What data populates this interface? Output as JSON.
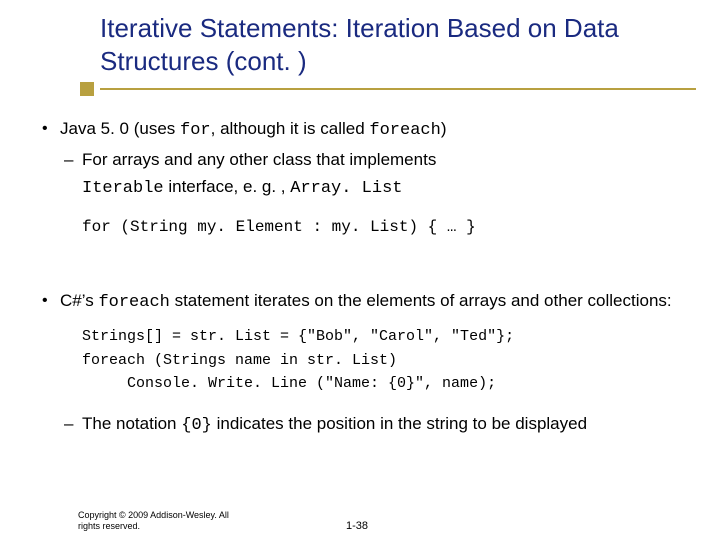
{
  "title": "Iterative Statements: Iteration Based on Data Structures (cont. )",
  "java": {
    "lead_a": "Java 5. 0 (uses ",
    "code_for": "for",
    "lead_b": ", although it is called ",
    "code_foreach": "foreach",
    "lead_c": ")",
    "sub1": "For arrays and any other class that implements",
    "sub2a": "Iterable",
    "sub2b": " interface, e. g. , ",
    "sub2c": "Array. List",
    "code": "for (String my. Element : my. List) { … }"
  },
  "csharp": {
    "lead_a": "C#’s ",
    "code_foreach": "foreach",
    "lead_b": " statement iterates on the elements of arrays and other collections:",
    "code1": "Strings[] = str. List = {\"Bob\", \"Carol\", \"Ted\"};",
    "code2": "foreach (Strings name in str. List)",
    "code3": "     Console. Write. Line (\"Name: {0}\", name);",
    "note_a": "The notation ",
    "note_code": "{0}",
    "note_b": " indicates the position in the string to be displayed"
  },
  "footer": {
    "copy": "Copyright © 2009 Addison-Wesley. All rights reserved.",
    "page": "1-38"
  }
}
